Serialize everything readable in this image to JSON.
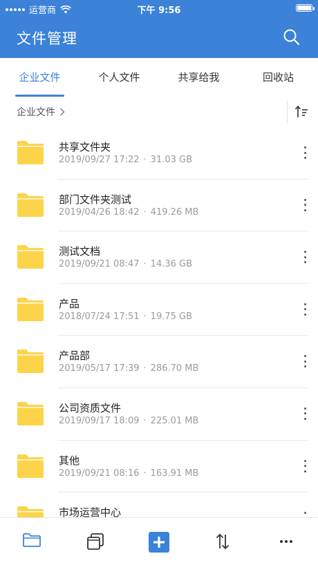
{
  "status_bar": {
    "carrier": "运营商",
    "time": "下午 9:56",
    "battery_level": 1.0
  },
  "header": {
    "title": "文件管理",
    "search_icon": "search-icon"
  },
  "tabs": [
    {
      "label": "企业文件",
      "active": true
    },
    {
      "label": "个人文件",
      "active": false
    },
    {
      "label": "共享给我",
      "active": false
    },
    {
      "label": "回收站",
      "active": false
    }
  ],
  "breadcrumb": {
    "label": "企业文件",
    "chevron_icon": "chevron-right-icon",
    "sort_icon": "sort-icon"
  },
  "files": [
    {
      "name": "共享文件夹",
      "date": "2019/09/27 17:22",
      "size": "31.03 GB"
    },
    {
      "name": "部门文件夹测试",
      "date": "2019/04/26 18:42",
      "size": "419.26 MB"
    },
    {
      "name": "测试文档",
      "date": "2019/09/21 08:47",
      "size": "14.36 GB"
    },
    {
      "name": "产品",
      "date": "2018/07/24 17:51",
      "size": "19.75 GB"
    },
    {
      "name": "产品部",
      "date": "2019/05/17 17:39",
      "size": "286.70 MB"
    },
    {
      "name": "公司资质文件",
      "date": "2019/09/17 18:09",
      "size": "225.01 MB"
    },
    {
      "name": "其他",
      "date": "2019/09/21 08:16",
      "size": "163.91 MB"
    },
    {
      "name": "市场运营中心",
      "date": "",
      "size": ""
    }
  ],
  "meta_separator": "·",
  "bottom_bar": {
    "items": [
      {
        "icon": "folder-icon",
        "active": true
      },
      {
        "icon": "recent-files-icon",
        "active": false
      },
      {
        "icon": "add-icon",
        "active": false
      },
      {
        "icon": "transfer-icon",
        "active": false
      },
      {
        "icon": "more-horizontal-icon",
        "active": false
      }
    ]
  },
  "colors": {
    "primary": "#3b82d8",
    "folder": "#fdd34a",
    "text": "#222222",
    "muted": "#9a9a9a"
  }
}
